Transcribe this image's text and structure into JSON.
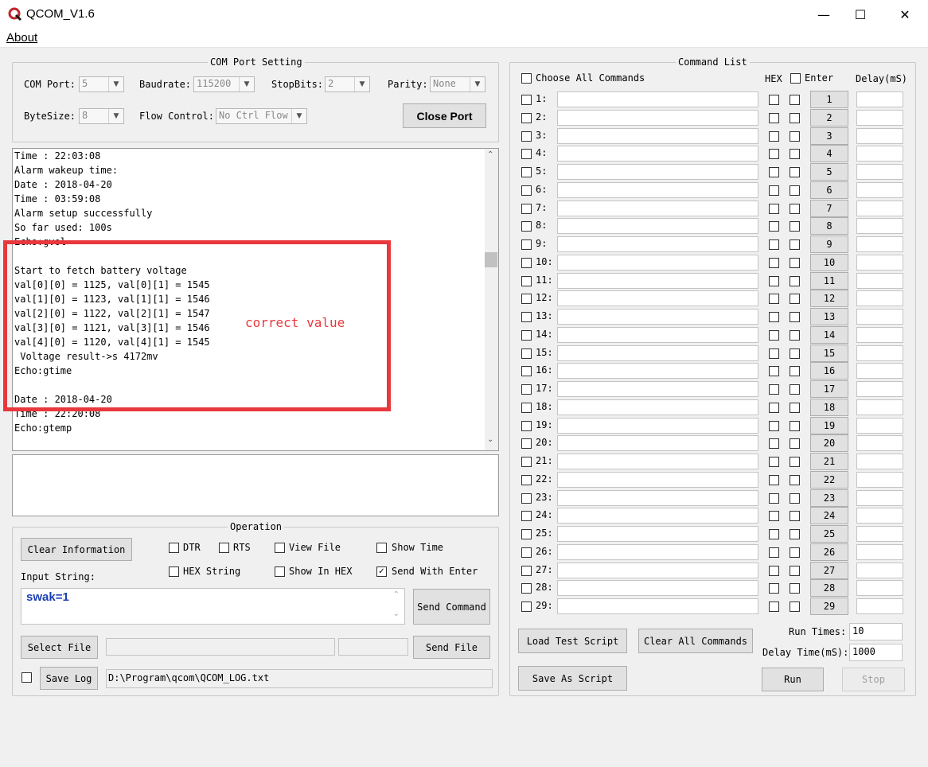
{
  "window": {
    "title": "QCOM_V1.6",
    "minimize": "—",
    "maximize": "☐",
    "close": "✕"
  },
  "menu": {
    "about": "About"
  },
  "com_port": {
    "legend": "COM Port Setting",
    "com_port_label": "COM Port:",
    "com_port_value": "5",
    "baudrate_label": "Baudrate:",
    "baudrate_value": "115200",
    "stopbits_label": "StopBits:",
    "stopbits_value": "2",
    "parity_label": "Parity:",
    "parity_value": "None",
    "bytesize_label": "ByteSize:",
    "bytesize_value": "8",
    "flow_label": "Flow Control:",
    "flow_value": "No Ctrl Flow",
    "close_port": "Close Port"
  },
  "console": {
    "lines": [
      "Time : 22:03:08",
      "Alarm wakeup time:",
      "Date : 2018-04-20",
      "Time : 03:59:08",
      "Alarm setup successfully",
      "So far used: 100s",
      "Echo:gvol",
      "",
      "Start to fetch battery voltage",
      "val[0][0] = 1125, val[0][1] = 1545",
      "val[1][0] = 1123, val[1][1] = 1546",
      "val[2][0] = 1122, val[2][1] = 1547",
      "val[3][0] = 1121, val[3][1] = 1546",
      "val[4][0] = 1120, val[4][1] = 1545",
      " Voltage result->s 4172mv",
      "Echo:gtime",
      "",
      "Date : 2018-04-20",
      "Time : 22:20:08",
      "Echo:gtemp"
    ],
    "annotation": "correct value",
    "annotation_color": "#e8383d"
  },
  "operation": {
    "legend": "Operation",
    "clear_info": "Clear Information",
    "dtr": "DTR",
    "rts": "RTS",
    "view_file": "View File",
    "show_time": "Show Time",
    "hex_string": "HEX String",
    "show_in_hex": "Show In HEX",
    "send_with_enter": "Send With Enter",
    "input_label": "Input String:",
    "input_value": "swak=1",
    "send_command": "Send Command",
    "select_file": "Select File",
    "send_file": "Send File",
    "save_log": "Save Log",
    "log_path": "D:\\Program\\qcom\\QCOM_LOG.txt"
  },
  "command_list": {
    "legend": "Command List",
    "choose_all": "Choose All Commands",
    "hex_header": "HEX",
    "enter_header": "Enter",
    "delay_header": "Delay(mS)",
    "rows": [
      "1",
      "2",
      "3",
      "4",
      "5",
      "6",
      "7",
      "8",
      "9",
      "10",
      "11",
      "12",
      "13",
      "14",
      "15",
      "16",
      "17",
      "18",
      "19",
      "20",
      "21",
      "22",
      "23",
      "24",
      "25",
      "26",
      "27",
      "28",
      "29"
    ],
    "load_script": "Load Test Script",
    "clear_all": "Clear All Commands",
    "save_script": "Save As Script",
    "run_times_label": "Run Times:",
    "run_times_value": "10",
    "delay_time_label": "Delay Time(mS):",
    "delay_time_value": "1000",
    "run": "Run",
    "stop": "Stop"
  }
}
